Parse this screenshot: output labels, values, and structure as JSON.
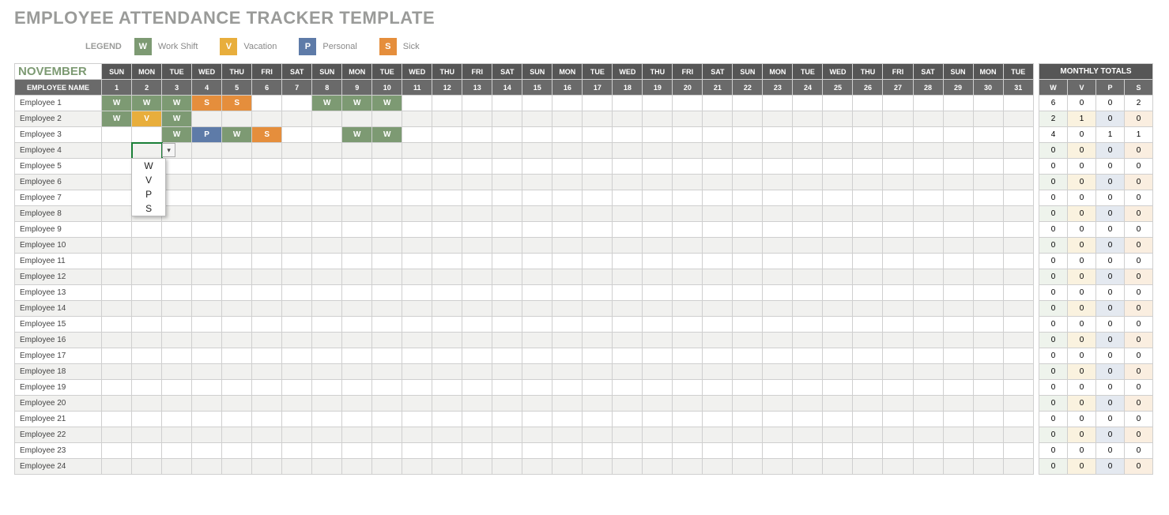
{
  "title": "EMPLOYEE ATTENDANCE TRACKER TEMPLATE",
  "legend": {
    "label": "LEGEND",
    "items": [
      {
        "code": "W",
        "text": "Work Shift"
      },
      {
        "code": "V",
        "text": "Vacation"
      },
      {
        "code": "P",
        "text": "Personal"
      },
      {
        "code": "S",
        "text": "Sick"
      }
    ]
  },
  "month": "NOVEMBER",
  "headers": {
    "employee_name": "EMPLOYEE NAME",
    "monthly_totals": "MONTHLY TOTALS",
    "days": [
      "SUN",
      "MON",
      "TUE",
      "WED",
      "THU",
      "FRI",
      "SAT",
      "SUN",
      "MON",
      "TUE",
      "WED",
      "THU",
      "FRI",
      "SAT",
      "SUN",
      "MON",
      "TUE",
      "WED",
      "THU",
      "FRI",
      "SAT",
      "SUN",
      "MON",
      "TUE",
      "WED",
      "THU",
      "FRI",
      "SAT",
      "SUN",
      "MON",
      "TUE"
    ],
    "dates": [
      "1",
      "2",
      "3",
      "4",
      "5",
      "6",
      "7",
      "8",
      "9",
      "10",
      "11",
      "12",
      "13",
      "14",
      "15",
      "16",
      "17",
      "18",
      "19",
      "20",
      "21",
      "22",
      "23",
      "24",
      "25",
      "26",
      "27",
      "28",
      "29",
      "30",
      "31"
    ],
    "total_cols": [
      "W",
      "V",
      "P",
      "S"
    ]
  },
  "employees": [
    {
      "name": "Employee 1",
      "att": {
        "1": "W",
        "2": "W",
        "3": "W",
        "4": "S",
        "5": "S",
        "8": "W",
        "9": "W",
        "10": "W"
      },
      "totals": [
        6,
        0,
        0,
        2
      ]
    },
    {
      "name": "Employee 2",
      "att": {
        "1": "W",
        "2": "V",
        "3": "W"
      },
      "totals": [
        2,
        1,
        0,
        0
      ]
    },
    {
      "name": "Employee 3",
      "att": {
        "3": "W",
        "4": "P",
        "5": "W",
        "6": "S",
        "9": "W",
        "10": "W"
      },
      "totals": [
        4,
        0,
        1,
        1
      ]
    },
    {
      "name": "Employee 4",
      "att": {},
      "totals": [
        0,
        0,
        0,
        0
      ],
      "activeCell": 2
    },
    {
      "name": "Employee 5",
      "att": {},
      "totals": [
        0,
        0,
        0,
        0
      ]
    },
    {
      "name": "Employee 6",
      "att": {},
      "totals": [
        0,
        0,
        0,
        0
      ]
    },
    {
      "name": "Employee 7",
      "att": {},
      "totals": [
        0,
        0,
        0,
        0
      ]
    },
    {
      "name": "Employee 8",
      "att": {},
      "totals": [
        0,
        0,
        0,
        0
      ]
    },
    {
      "name": "Employee 9",
      "att": {},
      "totals": [
        0,
        0,
        0,
        0
      ]
    },
    {
      "name": "Employee 10",
      "att": {},
      "totals": [
        0,
        0,
        0,
        0
      ]
    },
    {
      "name": "Employee 11",
      "att": {},
      "totals": [
        0,
        0,
        0,
        0
      ]
    },
    {
      "name": "Employee 12",
      "att": {},
      "totals": [
        0,
        0,
        0,
        0
      ]
    },
    {
      "name": "Employee 13",
      "att": {},
      "totals": [
        0,
        0,
        0,
        0
      ]
    },
    {
      "name": "Employee 14",
      "att": {},
      "totals": [
        0,
        0,
        0,
        0
      ]
    },
    {
      "name": "Employee 15",
      "att": {},
      "totals": [
        0,
        0,
        0,
        0
      ]
    },
    {
      "name": "Employee 16",
      "att": {},
      "totals": [
        0,
        0,
        0,
        0
      ]
    },
    {
      "name": "Employee 17",
      "att": {},
      "totals": [
        0,
        0,
        0,
        0
      ]
    },
    {
      "name": "Employee 18",
      "att": {},
      "totals": [
        0,
        0,
        0,
        0
      ]
    },
    {
      "name": "Employee 19",
      "att": {},
      "totals": [
        0,
        0,
        0,
        0
      ]
    },
    {
      "name": "Employee 20",
      "att": {},
      "totals": [
        0,
        0,
        0,
        0
      ]
    },
    {
      "name": "Employee 21",
      "att": {},
      "totals": [
        0,
        0,
        0,
        0
      ]
    },
    {
      "name": "Employee 22",
      "att": {},
      "totals": [
        0,
        0,
        0,
        0
      ]
    },
    {
      "name": "Employee 23",
      "att": {},
      "totals": [
        0,
        0,
        0,
        0
      ]
    },
    {
      "name": "Employee 24",
      "att": {},
      "totals": [
        0,
        0,
        0,
        0
      ]
    }
  ],
  "dropdown": {
    "open": true,
    "options": [
      "W",
      "V",
      "P",
      "S"
    ]
  }
}
